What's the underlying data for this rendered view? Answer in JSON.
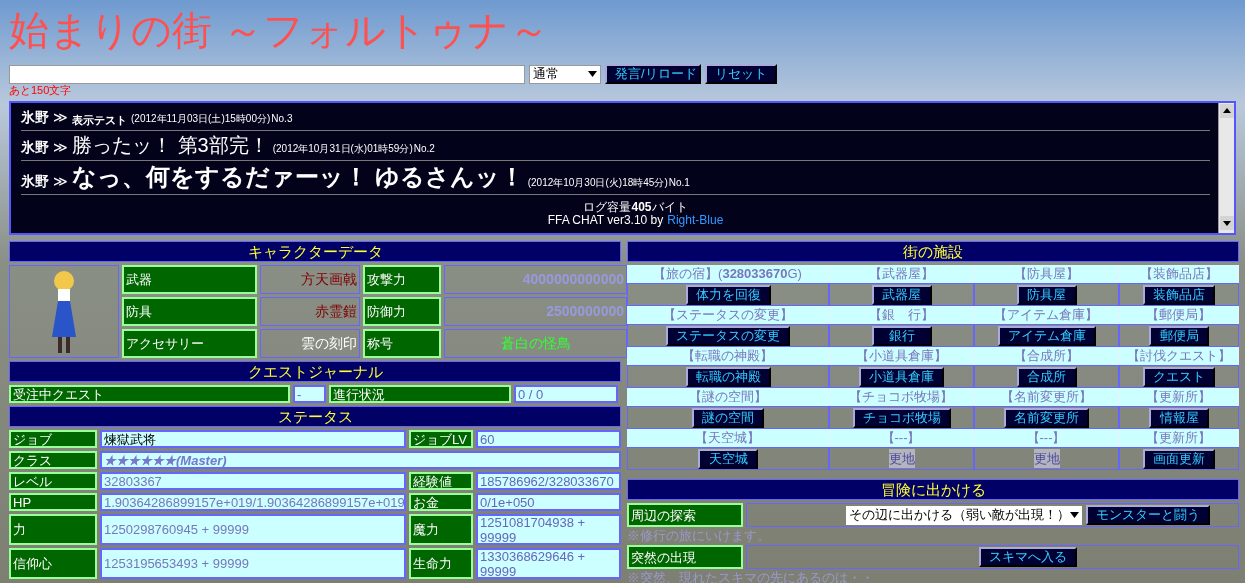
{
  "title": "始まりの街 ～フォルトゥナ～",
  "chat_form": {
    "mode": "通常",
    "submit": "発言/リロード",
    "reset": "リセット",
    "remaining": "あと150文字"
  },
  "messages": [
    {
      "name": "氷野",
      "sep": "≫",
      "text": "表示テスト",
      "date": "(2012年11月03日(土)15時00分)",
      "no": "No.3",
      "kind": "note"
    },
    {
      "name": "氷野",
      "sep": "≫",
      "text": "勝ったッ！ 第3部完！",
      "date": "(2012年10月31日(水)01時59分)",
      "no": "No.2",
      "kind": "shout"
    },
    {
      "name": "氷野",
      "sep": "≫",
      "text": "なっ、何をするだァーッ！ ゆるさんッ！",
      "date": "(2012年10月30日(火)18時45分)",
      "no": "No.1",
      "kind": "scream"
    }
  ],
  "chat_footer": {
    "log_size": "ログ容量**405**バイト",
    "credit": "FFA CHAT ver3.10 by",
    "credit_link": "Right-Blue"
  },
  "character": {
    "header": "キャラクターデータ",
    "rows": [
      {
        "label": "武器",
        "value": "方天画戟",
        "color": "#800000",
        "stat_label": "攻撃力",
        "stat_value": "4000000000000",
        "kind": "number"
      },
      {
        "label": "防具",
        "value": "赤霊鎧",
        "color": "#800000",
        "stat_label": "防御力",
        "stat_value": "2500000000",
        "kind": "number"
      },
      {
        "label": "アクセサリー",
        "value": "雲の刻印",
        "color": "#ffffff",
        "stat_label": "称号",
        "stat_value": "蒼白の怪鳥",
        "kind": "title"
      }
    ]
  },
  "quest": {
    "header": "クエストジャーナル",
    "label": "受注中クエスト",
    "value": "-",
    "progress_label": "進行状況",
    "progress": "0 / 0"
  },
  "status": {
    "header": "ステータス",
    "rows": [
      {
        "kind": "pair",
        "label": "ジョブ",
        "value": "煉獄武将",
        "label2": "ジョブLV",
        "value2": "60"
      },
      {
        "kind": "wide",
        "label": "クラス",
        "value": "★★★★★★(Master)"
      },
      {
        "kind": "pair",
        "label": "レベル",
        "value": "32803367",
        "label2": "経験値",
        "value2": "185786962/328033670"
      },
      {
        "kind": "pair",
        "label": "HP",
        "value": "1.90364286899157e+019/1.90364286899157e+019",
        "label2": "お金",
        "value2": "0/1e+050"
      },
      {
        "kind": "tall",
        "label": "力",
        "value": "1250298760945 + 99999",
        "label2": "魔力",
        "value2": "1251081704938 + 99999"
      },
      {
        "kind": "tall",
        "label": "信仰心",
        "value": "1253195653493 + 99999",
        "label2": "生命力",
        "value2": "1330368629646 + 99999"
      }
    ]
  },
  "facilities": {
    "header": "街の施設",
    "rows": [
      [
        {
          "label": "【旅の宿】(**328033670**G)",
          "action": "体力を回復",
          "kind": "button"
        },
        {
          "label": "【武器屋】",
          "action": "武器屋",
          "kind": "button"
        },
        {
          "label": "【防具屋】",
          "action": "防具屋",
          "kind": "button"
        },
        {
          "label": "【装飾品店】",
          "action": "装飾品店",
          "kind": "button"
        }
      ],
      [
        {
          "label": "【ステータスの変更】",
          "action": "ステータスの変更",
          "kind": "button"
        },
        {
          "label": "【銀　行】",
          "action": "銀行",
          "kind": "button"
        },
        {
          "label": "【アイテム倉庫】",
          "action": "アイテム倉庫",
          "kind": "button"
        },
        {
          "label": "【郵便局】",
          "action": "郵便局",
          "kind": "button"
        }
      ],
      [
        {
          "label": "【転職の神殿】",
          "action": "転職の神殿",
          "kind": "button"
        },
        {
          "label": "【小道具倉庫】",
          "action": "小道具倉庫",
          "kind": "button"
        },
        {
          "label": "【合成所】",
          "action": "合成所",
          "kind": "button"
        },
        {
          "label": "【討伐クエスト】",
          "action": "クエスト",
          "kind": "button"
        }
      ],
      [
        {
          "label": "【謎の空間】",
          "action": "謎の空間",
          "kind": "button"
        },
        {
          "label": "【チョコボ牧場】",
          "action": "チョコボ牧場",
          "kind": "button"
        },
        {
          "label": "【名前変更所】",
          "action": "名前変更所",
          "kind": "button"
        },
        {
          "label": "【更新所】",
          "action": "情報屋",
          "kind": "button"
        }
      ],
      [
        {
          "label": "【天空城】",
          "action": "天空城",
          "kind": "button"
        },
        {
          "label": "【---】",
          "action": "更地",
          "kind": "text"
        },
        {
          "label": "【---】",
          "action": "更地",
          "kind": "text"
        },
        {
          "label": "【更新所】",
          "action": "画面更新",
          "kind": "button"
        }
      ]
    ]
  },
  "adventure": {
    "header": "冒険に出かける",
    "rows": [
      {
        "label": "周辺の探索",
        "select": "その辺に出かける（弱い敵が出現！）",
        "button": "モンスターと闘う",
        "note": "※修行の旅にいけます。"
      },
      {
        "label": "突然の出現",
        "button": "スキマへ入る",
        "note": "※突然、現れたスキマの先にあるのは・・"
      }
    ]
  }
}
